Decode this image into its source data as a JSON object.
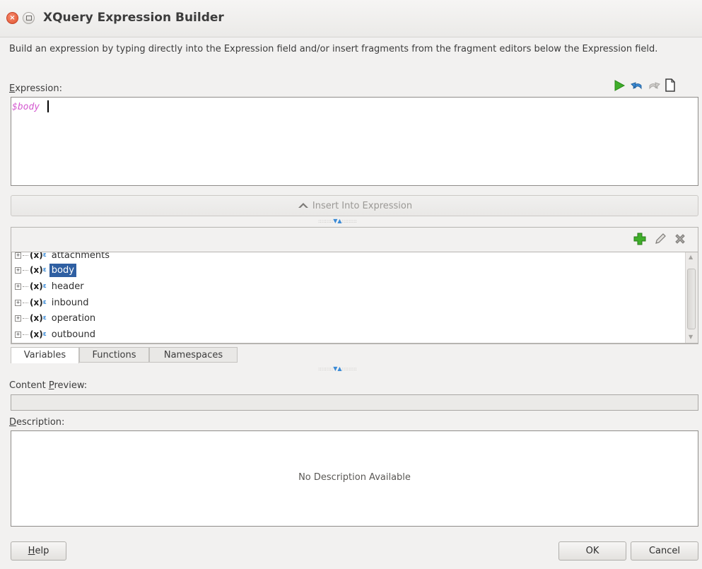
{
  "window": {
    "title": "XQuery Expression Builder"
  },
  "intro": "Build an expression by typing directly into the Expression field and/or insert fragments from the fragment editors below the Expression field.",
  "expression": {
    "label_prefix": "",
    "label_mnemonic": "E",
    "label_rest": "xpression:",
    "value": "$body",
    "toolbar": [
      "run-icon",
      "undo-icon",
      "redo-icon",
      "new-document-icon"
    ]
  },
  "insert_button": {
    "label": "Insert Into Expression"
  },
  "fragment_toolbar": [
    "add-icon",
    "edit-icon",
    "delete-icon"
  ],
  "tree": {
    "items": [
      {
        "label": "attachments",
        "selected": false
      },
      {
        "label": "body",
        "selected": true
      },
      {
        "label": "header",
        "selected": false
      },
      {
        "label": "inbound",
        "selected": false
      },
      {
        "label": "operation",
        "selected": false
      },
      {
        "label": "outbound",
        "selected": false
      }
    ]
  },
  "tabs": [
    "Variables",
    "Functions",
    "Namespaces"
  ],
  "content_preview": {
    "label_prefix": "Content ",
    "label_mnemonic": "P",
    "label_rest": "review:",
    "value": ""
  },
  "description": {
    "label_prefix": "",
    "label_mnemonic": "D",
    "label_rest": "escription:",
    "text": "No Description Available"
  },
  "buttons": {
    "help_mnemonic": "H",
    "help_rest": "elp",
    "ok": "OK",
    "cancel": "Cancel"
  },
  "colors": {
    "selection": "#2f5fa2",
    "expression_text": "#d45ad0",
    "close_button": "#e0542c",
    "add_icon": "#3fae2a",
    "run_icon": "#3fae2a"
  }
}
